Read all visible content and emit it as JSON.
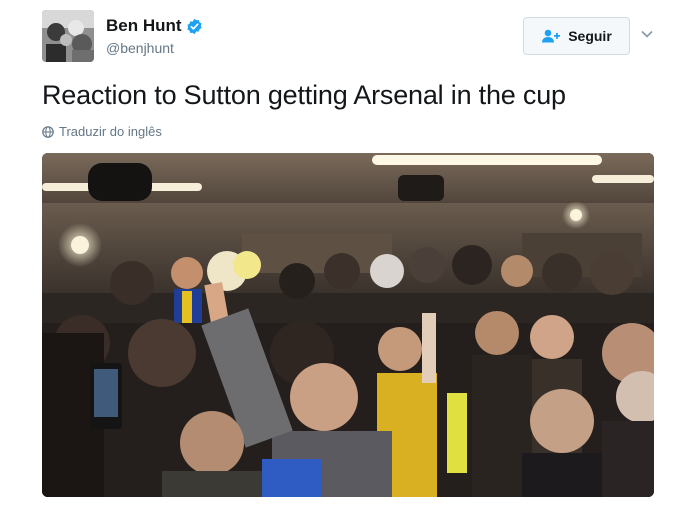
{
  "author": {
    "display_name": "Ben Hunt",
    "handle": "@benjhunt",
    "verified": true
  },
  "follow_button": {
    "label": "Seguir",
    "icon": "add-user-icon"
  },
  "menu": {
    "icon": "chevron-down-icon"
  },
  "tweet": {
    "text": "Reaction to Sutton getting Arsenal in the cup",
    "translate_label": "Traduzir do inglês",
    "translate_icon": "globe-icon"
  },
  "media": {
    "description_icon": "video-frame"
  },
  "colors": {
    "text": "#14171a",
    "secondary": "#657786",
    "verified_blue": "#1da1f2",
    "button_bg": "#f5f8fa"
  }
}
